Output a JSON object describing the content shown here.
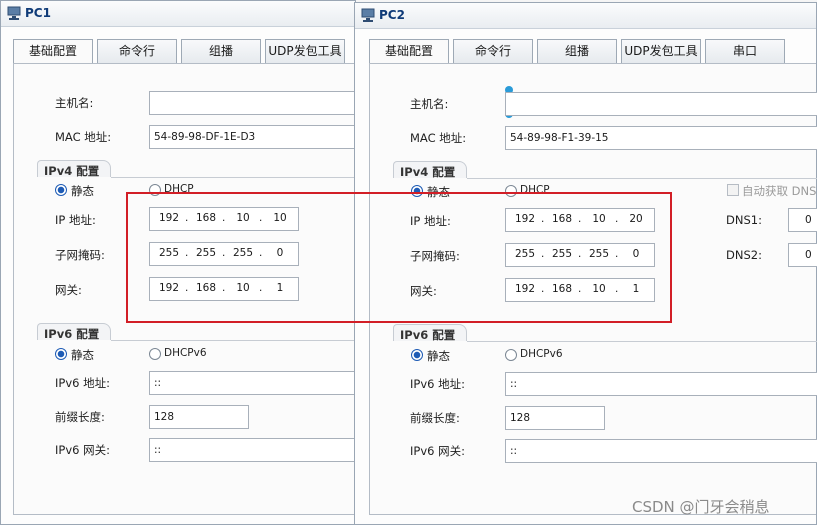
{
  "pc1": {
    "title": "PC1",
    "tabs": [
      "基础配置",
      "命令行",
      "组播",
      "UDP发包工具"
    ],
    "hostname_label": "主机名:",
    "hostname_value": "",
    "mac_label": "MAC 地址:",
    "mac_value": "54-89-98-DF-1E-D3",
    "ipv4_group": "IPv4 配置",
    "static_label": "静态",
    "dhcp_label": "DHCP",
    "ip_label": "IP 地址:",
    "ip": [
      "192",
      "168",
      "10",
      "10"
    ],
    "mask_label": "子网掩码:",
    "mask": [
      "255",
      "255",
      "255",
      "0"
    ],
    "gw_label": "网关:",
    "gw": [
      "192",
      "168",
      "10",
      "1"
    ],
    "ipv6_group": "IPv6 配置",
    "static6_label": "静态",
    "dhcp6_label": "DHCPv6",
    "ipv6_label": "IPv6 地址:",
    "ipv6_value": "::",
    "prefix_label": "前缀长度:",
    "prefix_value": "128",
    "gw6_label": "IPv6 网关:",
    "gw6_value": "::"
  },
  "pc2": {
    "title": "PC2",
    "tabs": [
      "基础配置",
      "命令行",
      "组播",
      "UDP发包工具",
      "串口"
    ],
    "hostname_label": "主机名:",
    "hostname_value": "",
    "mac_label": "MAC 地址:",
    "mac_value": "54-89-98-F1-39-15",
    "ipv4_group": "IPv4 配置",
    "static_label": "静态",
    "dhcp_label": "DHCP",
    "auto_dns_label": "自动获取 DNS",
    "ip_label": "IP 地址:",
    "ip": [
      "192",
      "168",
      "10",
      "20"
    ],
    "mask_label": "子网掩码:",
    "mask": [
      "255",
      "255",
      "255",
      "0"
    ],
    "gw_label": "网关:",
    "gw": [
      "192",
      "168",
      "10",
      "1"
    ],
    "dns1_label": "DNS1:",
    "dns1_first": "0",
    "dns2_label": "DNS2:",
    "dns2_first": "0",
    "ipv6_group": "IPv6 配置",
    "static6_label": "静态",
    "dhcp6_label": "DHCPv6",
    "ipv6_label": "IPv6 地址:",
    "ipv6_value": "::",
    "prefix_label": "前缀长度:",
    "prefix_value": "128",
    "gw6_label": "IPv6 网关:",
    "gw6_value": "::"
  },
  "watermark": "CSDN @门牙会稍息",
  "colors": {
    "highlight": "#d21e26",
    "accent": "#1d5bb5",
    "title": "#0f3b78"
  }
}
